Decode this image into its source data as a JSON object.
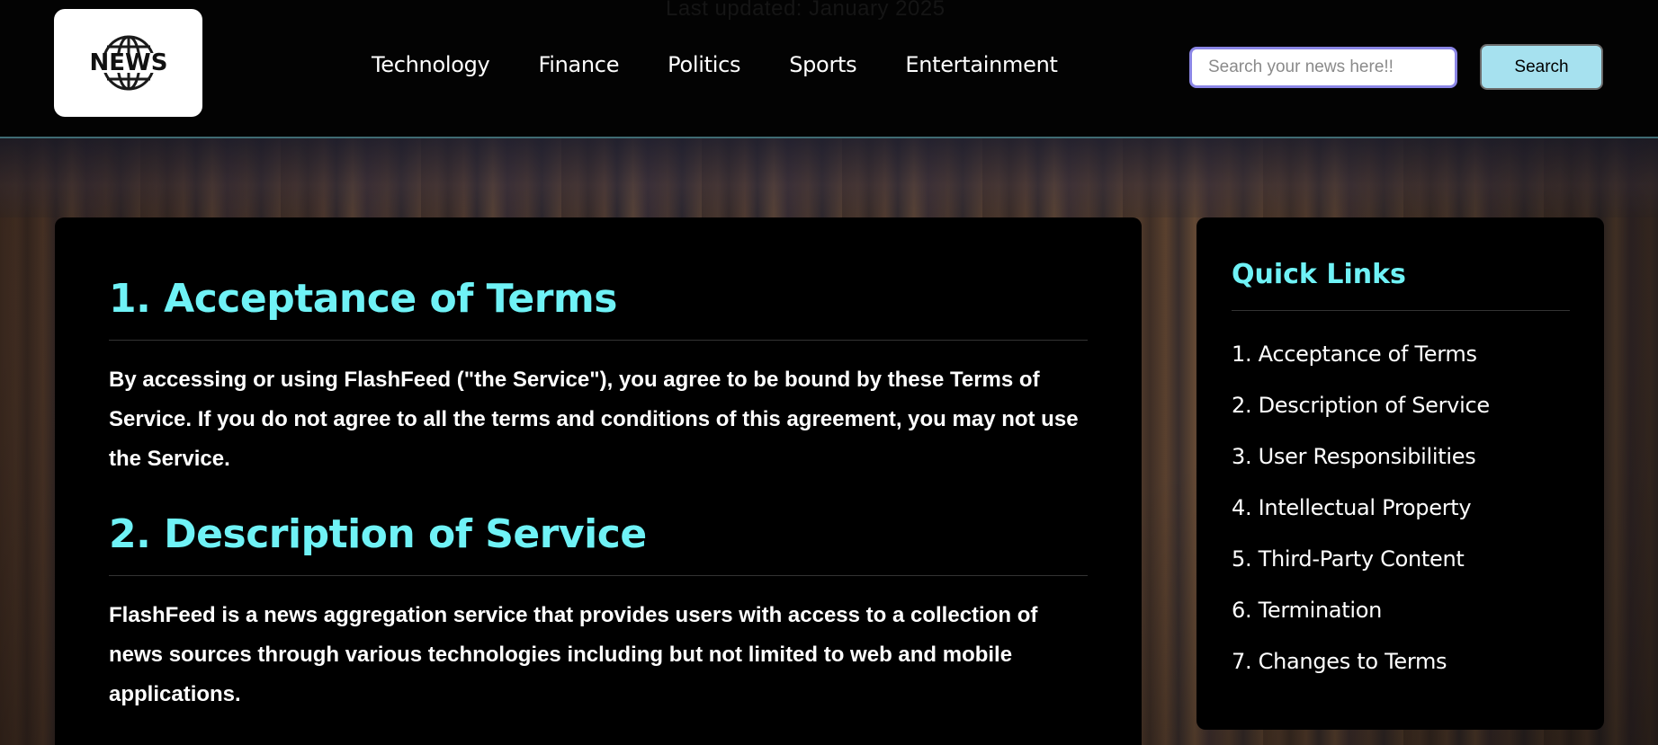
{
  "header": {
    "ghost_text": "Last updated: January 2025",
    "logo_text": "NEWS",
    "nav": [
      "Technology",
      "Finance",
      "Politics",
      "Sports",
      "Entertainment"
    ],
    "search": {
      "placeholder": "Search your news here!!",
      "value": "",
      "button_label": "Search"
    }
  },
  "main": {
    "sections": [
      {
        "heading": "1. Acceptance of Terms",
        "body": "By accessing or using FlashFeed (\"the Service\"), you agree to be bound by these Terms of Service. If you do not agree to all the terms and conditions of this agreement, you may not use the Service."
      },
      {
        "heading": "2. Description of Service",
        "body": "FlashFeed is a news aggregation service that provides users with access to a collection of news sources through various technologies including but not limited to web and mobile applications."
      }
    ]
  },
  "sidebar": {
    "title": "Quick Links",
    "links": [
      "1. Acceptance of Terms",
      "2. Description of Service",
      "3. User Responsibilities",
      "4. Intellectual Property",
      "5. Third-Party Content",
      "6. Termination",
      "7. Changes to Terms"
    ]
  },
  "colors": {
    "accent": "#6ff2f6",
    "search_button": "#a6e1ef",
    "search_border": "#8b86e6",
    "background": "#000000"
  },
  "icons": {
    "logo": "globe-icon"
  }
}
